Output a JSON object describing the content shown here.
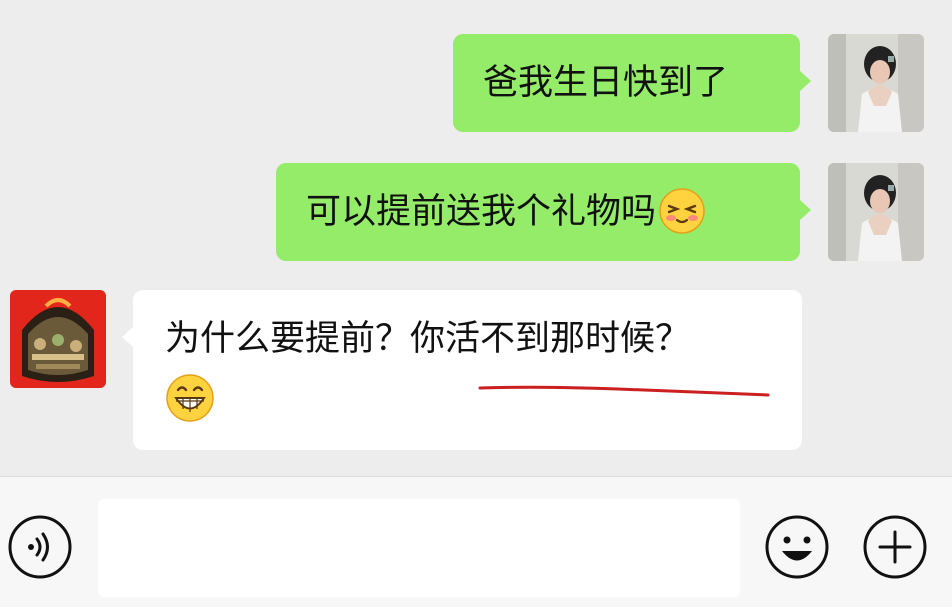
{
  "messages": [
    {
      "sender": "self",
      "text": "爸我生日快到了"
    },
    {
      "sender": "self",
      "text": "可以提前送我个礼物吗",
      "emoji": "shy-face-icon"
    },
    {
      "sender": "other",
      "text": "为什么要提前？你活不到那时候？",
      "emoji": "grinning-face-icon"
    }
  ],
  "colors": {
    "self_bubble": "#95ec69",
    "other_bubble": "#ffffff",
    "background": "#ededed",
    "underline": "#cc1f1f"
  },
  "input": {
    "value": "",
    "placeholder": ""
  },
  "toolbar": {
    "voice_icon": "voice-icon",
    "emoji_icon": "emoji-icon",
    "plus_icon": "plus-icon"
  }
}
